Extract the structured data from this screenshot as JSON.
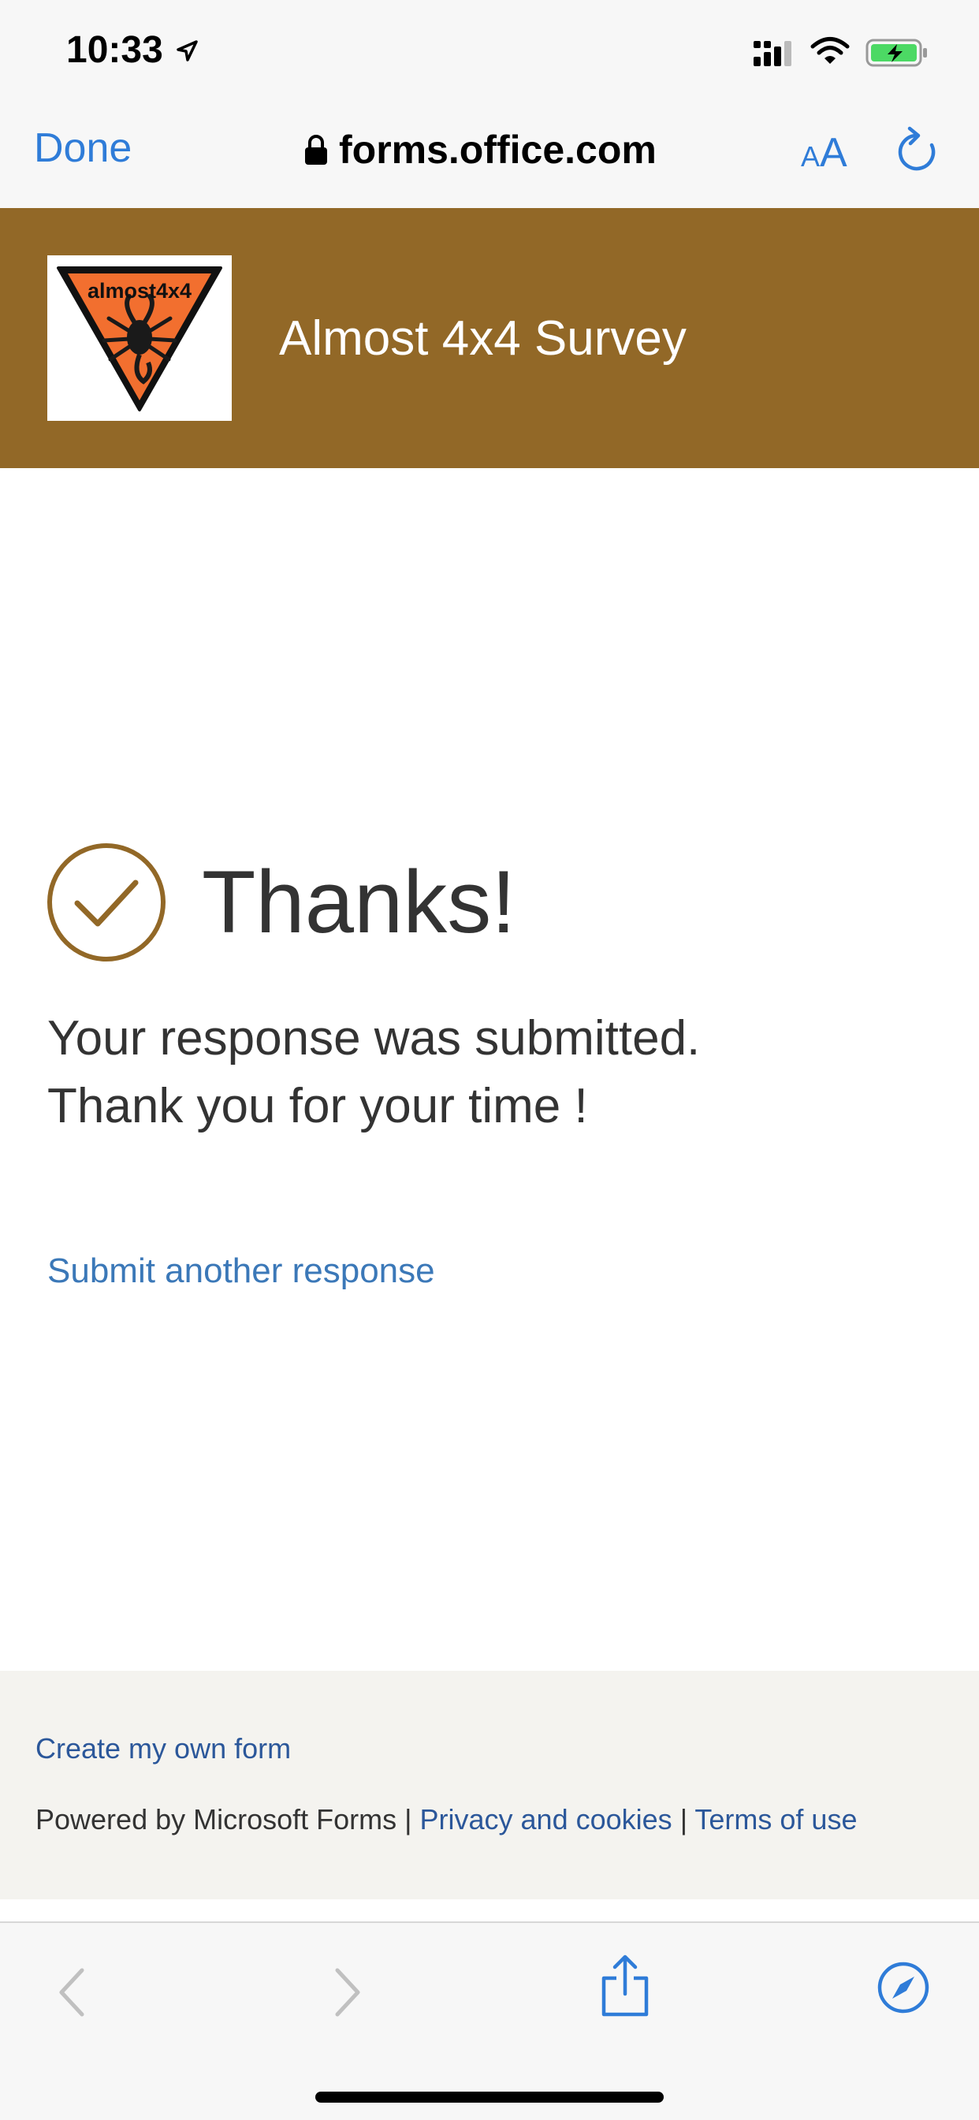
{
  "status_bar": {
    "time": "10:33",
    "icons": [
      "location-arrow-icon",
      "cellular-signal-icon",
      "wifi-icon",
      "battery-charging-icon"
    ],
    "battery_color": "#4cd964"
  },
  "browser": {
    "done_label": "Done",
    "url": "forms.office.com",
    "text_size_label_small": "A",
    "text_size_label_large": "A",
    "accent_color": "#2f7cd8"
  },
  "form": {
    "title": "Almost 4x4 Survey",
    "logo_text": "almost4x4",
    "header_color": "#926827"
  },
  "confirmation": {
    "heading": "Thanks!",
    "line1": "Your response was submitted.",
    "line2": "Thank you for your time !",
    "submit_another": "Submit another response"
  },
  "footer": {
    "create_form": "Create my own form",
    "powered_by": "Powered by Microsoft Forms",
    "separator": "|",
    "privacy": "Privacy and cookies",
    "terms": "Terms of use"
  },
  "toolbar": {
    "icons": [
      "back-icon",
      "forward-icon",
      "share-icon",
      "compass-icon"
    ]
  }
}
